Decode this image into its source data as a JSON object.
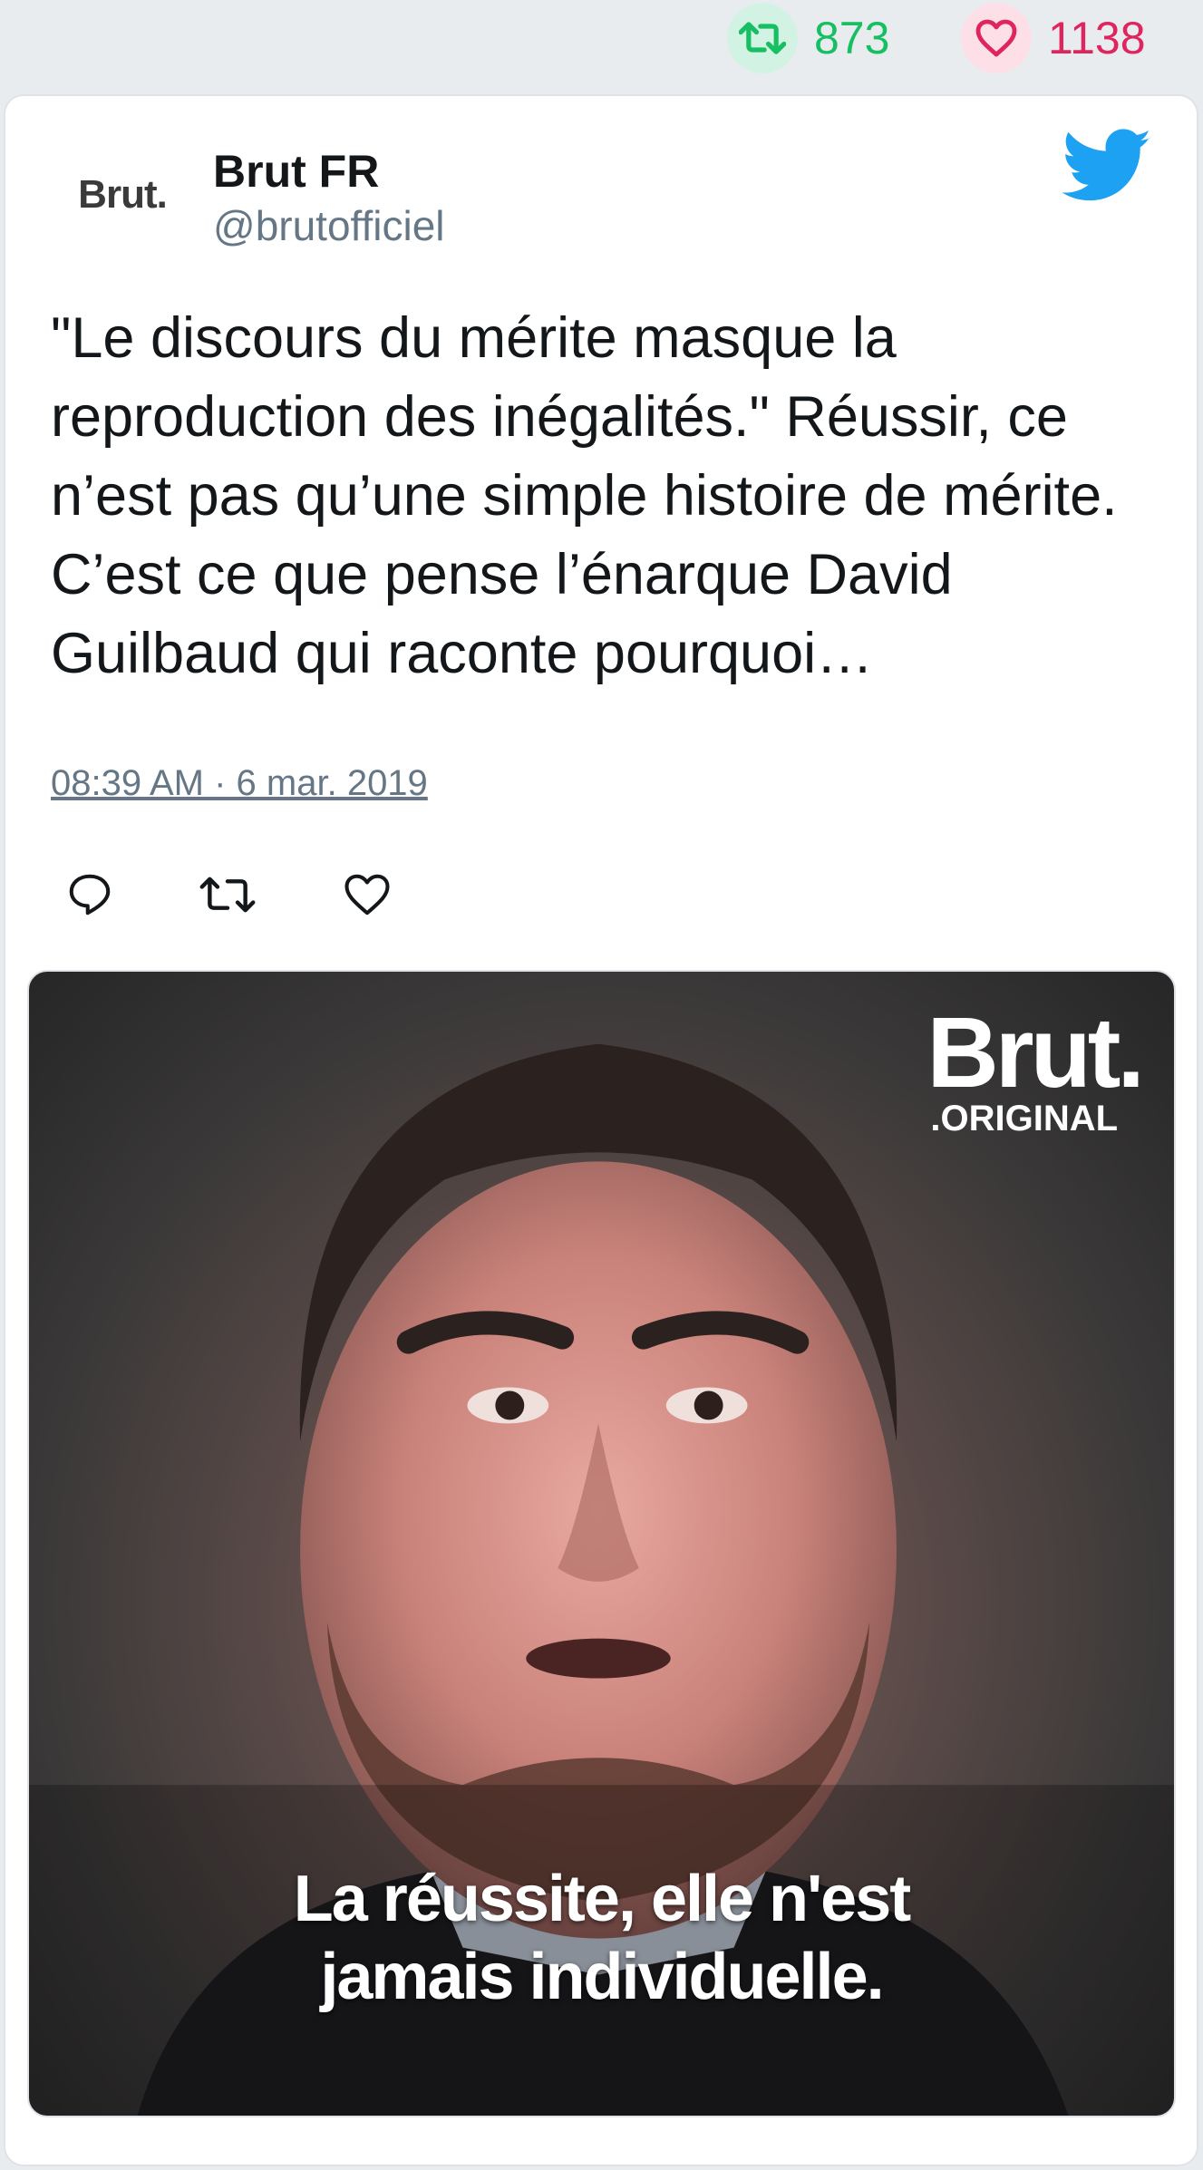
{
  "stats": {
    "retweets": "873",
    "likes": "1138",
    "retweet_color": "#17bf63",
    "like_color": "#e0245e"
  },
  "tweet": {
    "avatar_text": "Brut.",
    "display_name": "Brut FR",
    "handle": "@brutofficiel",
    "text": "\"Le discours du mérite masque la reproduction des inégalités.\" Réussir, ce n’est pas qu’une simple histoire de mérite. C’est ce que pense l’énarque David Guilbaud qui raconte pourquoi…",
    "timestamp": "08:39 AM · 6 mar. 2019"
  },
  "actions": [
    "reply-icon",
    "retweet-icon",
    "like-icon"
  ],
  "media": {
    "brand_title": "Brut.",
    "brand_subtitle": ".ORIGINAL",
    "caption_line1": "La réussite, elle n'est",
    "caption_line2": "jamais individuelle."
  },
  "colors": {
    "twitter_blue": "#1da1f2",
    "text_primary": "#14171a",
    "text_secondary": "#657786"
  }
}
